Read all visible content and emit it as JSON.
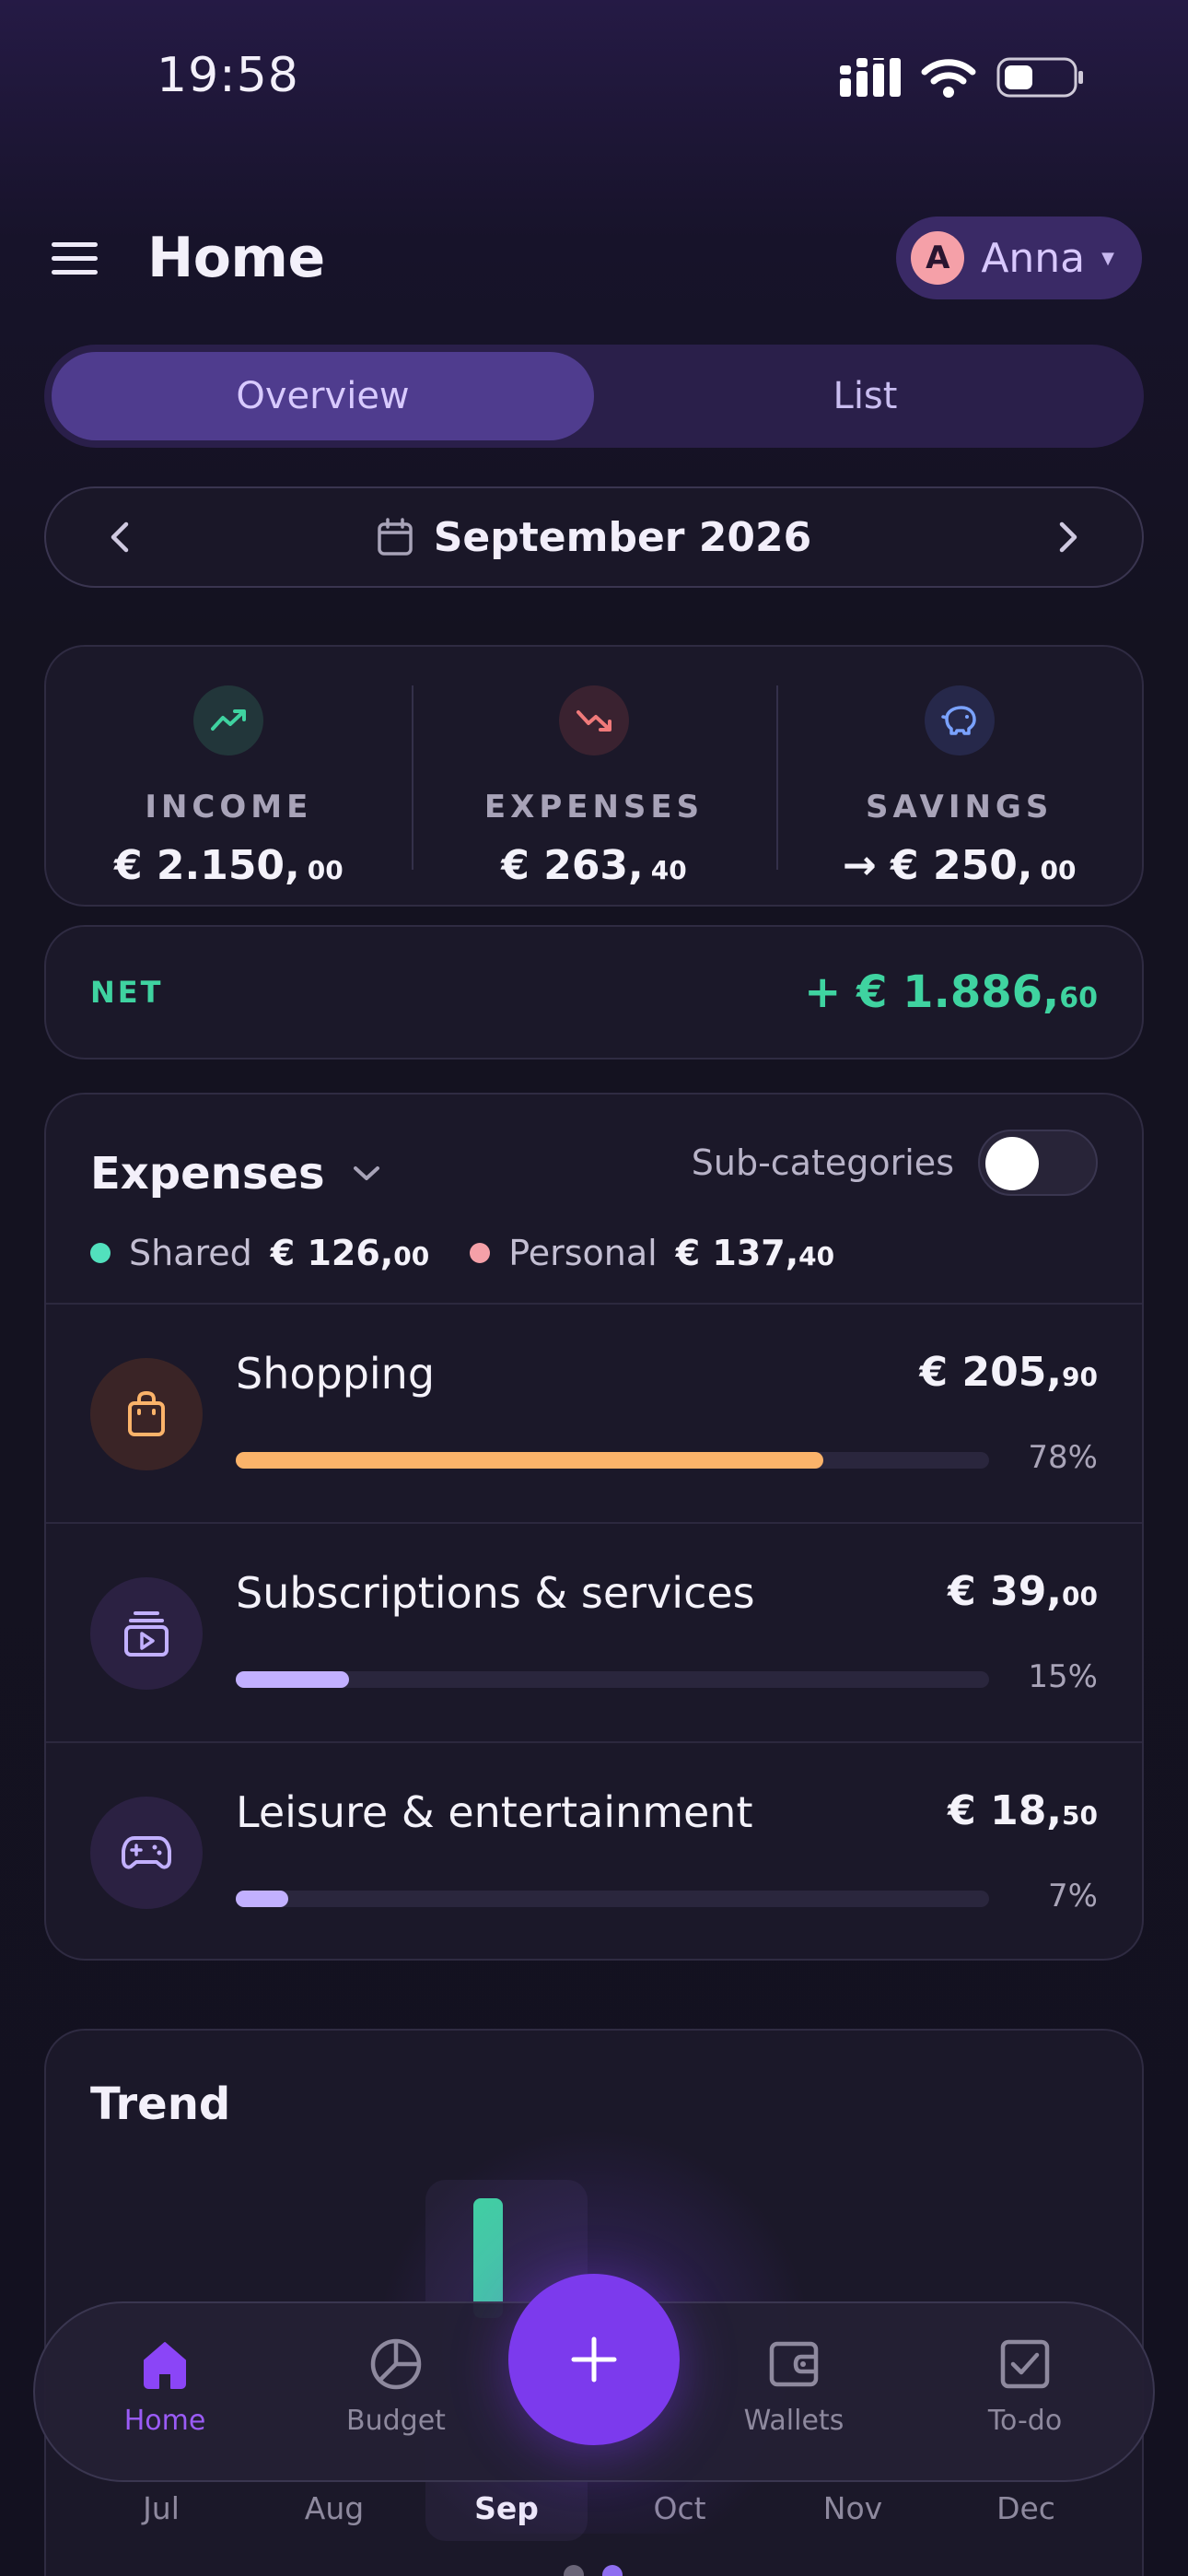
{
  "status_bar": {
    "time": "19:58"
  },
  "header": {
    "title": "Home",
    "user_initial": "A",
    "user_name": "Anna"
  },
  "tabs": [
    {
      "label": "Overview",
      "active": true
    },
    {
      "label": "List",
      "active": false
    }
  ],
  "month": {
    "label": "September 2026"
  },
  "summary": {
    "income": {
      "label": "INCOME",
      "value": "€ 2.150,",
      "cents": "00",
      "color": "#3fd3a0"
    },
    "expenses": {
      "label": "EXPENSES",
      "value": "€ 263,",
      "cents": "40",
      "color": "#f07a7a"
    },
    "savings": {
      "label": "SAVINGS",
      "value": "→ € 250,",
      "cents": "00",
      "color": "#7aa2ff"
    }
  },
  "net": {
    "label": "NET",
    "value": "+ € 1.886,",
    "cents": "60"
  },
  "expenses_card": {
    "title": "Expenses",
    "subcategories_label": "Sub-categories",
    "subcategories_on": false,
    "legend": [
      {
        "name": "Shared",
        "value": "€ 126,",
        "cents": "00",
        "color": "#52e0bd"
      },
      {
        "name": "Personal",
        "value": "€ 137,",
        "cents": "40",
        "color": "#f5a0a8"
      }
    ],
    "categories": [
      {
        "name": "Shopping",
        "value": "€ 205,",
        "cents": "90",
        "percent_label": "78%",
        "percent": 0.78,
        "icon": "shopping-bag-icon",
        "color": "#fbb36a",
        "icon_bg": "#3a2426"
      },
      {
        "name": "Subscriptions & services",
        "value": "€ 39,",
        "cents": "00",
        "percent_label": "15%",
        "percent": 0.15,
        "icon": "subscriptions-icon",
        "color": "#c2b0ff",
        "icon_bg": "#2b2142"
      },
      {
        "name": "Leisure & entertainment",
        "value": "€ 18,",
        "cents": "50",
        "percent_label": "7%",
        "percent": 0.07,
        "icon": "gamepad-icon",
        "color": "#c2b0ff",
        "icon_bg": "#2b2142"
      }
    ]
  },
  "trend": {
    "title": "Trend",
    "months": [
      "Jul",
      "Aug",
      "Sep",
      "Oct",
      "Nov",
      "Dec"
    ],
    "selected_month": "Sep"
  },
  "bottom_nav": {
    "items": [
      {
        "label": "Home",
        "icon": "home-icon",
        "active": true
      },
      {
        "label": "Budget",
        "icon": "pie-chart-icon",
        "active": false
      },
      {
        "label": "Wallets",
        "icon": "wallet-icon",
        "active": false
      },
      {
        "label": "To-do",
        "icon": "checkbox-icon",
        "active": false
      }
    ],
    "fab_icon": "plus-icon"
  },
  "colors": {
    "accent": "#7c3aed",
    "positive": "#3fd3a0"
  }
}
